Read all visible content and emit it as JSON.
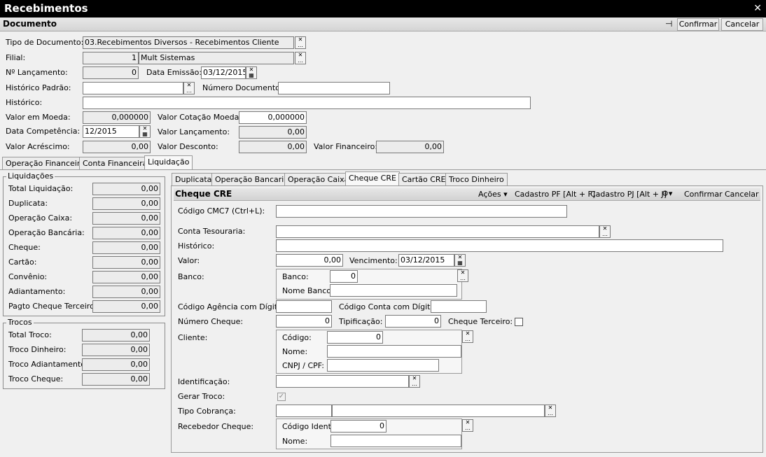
{
  "window": {
    "title": "Recebimentos"
  },
  "documento": {
    "title": "Documento",
    "confirm_label": "Confirmar",
    "cancel_label": "Cancelar",
    "tipo_documento_label": "Tipo de Documento:",
    "tipo_documento_value": "03.Recebimentos Diversos - Recebimentos Cliente",
    "filial_label": "Filial:",
    "filial_code": "1",
    "filial_name": "Mult Sistemas",
    "lancamento_label": "Nº Lançamento:",
    "lancamento_value": "0",
    "data_emissao_label": "Data Emissão:",
    "data_emissao_value": "03/12/2015",
    "historico_padrao_label": "Histórico Padrão:",
    "numero_documento_label": "Número Documento:",
    "historico_label": "Histórico:",
    "valor_moeda_label": "Valor em Moeda:",
    "valor_moeda_value": "0,000000",
    "valor_cotacao_label": "Valor Cotação Moeda:",
    "valor_cotacao_value": "0,000000",
    "data_competencia_label": "Data Competência:",
    "data_competencia_value": "12/2015",
    "valor_lancamento_label": "Valor Lançamento:",
    "valor_lancamento_value": "0,00",
    "valor_acrescimo_label": "Valor Acréscimo:",
    "valor_acrescimo_value": "0,00",
    "valor_desconto_label": "Valor Desconto:",
    "valor_desconto_value": "0,00",
    "valor_financeiro_label": "Valor Financeiro:",
    "valor_financeiro_value": "0,00"
  },
  "main_tabs": [
    "Operação Financeira",
    "Conta Financeira",
    "Liquidação"
  ],
  "liquidacoes": {
    "title": "Liquidações",
    "rows": [
      {
        "label": "Total Liquidação:",
        "value": "0,00"
      },
      {
        "label": "Duplicata:",
        "value": "0,00"
      },
      {
        "label": "Operação Caixa:",
        "value": "0,00"
      },
      {
        "label": "Operação Bancária:",
        "value": "0,00"
      },
      {
        "label": "Cheque:",
        "value": "0,00"
      },
      {
        "label": "Cartão:",
        "value": "0,00"
      },
      {
        "label": "Convênio:",
        "value": "0,00"
      },
      {
        "label": "Adiantamento:",
        "value": "0,00"
      },
      {
        "label": "Pagto Cheque Terceiro:",
        "value": "0,00"
      }
    ]
  },
  "trocos": {
    "title": "Trocos",
    "rows": [
      {
        "label": "Total Troco:",
        "value": "0,00"
      },
      {
        "label": "Troco Dinheiro:",
        "value": "0,00"
      },
      {
        "label": "Troco Adiantamento:",
        "value": "0,00"
      },
      {
        "label": "Troco Cheque:",
        "value": "0,00"
      }
    ]
  },
  "sub_tabs": [
    "Duplicata",
    "Operação Bancaria",
    "Operação Caixa",
    "Cheque CRE",
    "Cartão CRE",
    "Troco Dinheiro"
  ],
  "cheque": {
    "title": "Cheque CRE",
    "acoes_label": "Ações",
    "cadastro_pf_label": "Cadastro PF [Alt + F]",
    "cadastro_pj_label": "Cadastro PJ [Alt + J]",
    "confirm_label": "Confirmar",
    "cancel_label": "Cancelar",
    "cmc7_label": "Código CMC7 (Ctrl+L):",
    "conta_tesouraria_label": "Conta Tesouraria:",
    "historico_label": "Histórico:",
    "valor_label": "Valor:",
    "valor_value": "0,00",
    "vencimento_label": "Vencimento:",
    "vencimento_value": "03/12/2015",
    "banco_label": "Banco:",
    "banco_code_label": "Banco:",
    "banco_code_value": "0",
    "nome_banco_label": "Nome Banco:",
    "agencia_label": "Código Agência com Dígito:",
    "conta_label": "Código Conta com Dígito:",
    "numero_cheque_label": "Número Cheque:",
    "numero_cheque_value": "0",
    "tipificacao_label": "Tipificação:",
    "tipificacao_value": "0",
    "cheque_terceiro_label": "Cheque Terceiro:",
    "cliente_label": "Cliente:",
    "cliente_codigo_label": "Código:",
    "cliente_codigo_value": "0",
    "cliente_nome_label": "Nome:",
    "cliente_cnpj_label": "CNPJ / CPF:",
    "identificacao_label": "Identificação:",
    "gerar_troco_label": "Gerar Troco:",
    "tipo_cobranca_label": "Tipo Cobrança:",
    "recebedor_label": "Recebedor Cheque:",
    "recebedor_codigo_label": "Código Ident.:",
    "recebedor_codigo_value": "0",
    "recebedor_nome_label": "Nome:"
  }
}
